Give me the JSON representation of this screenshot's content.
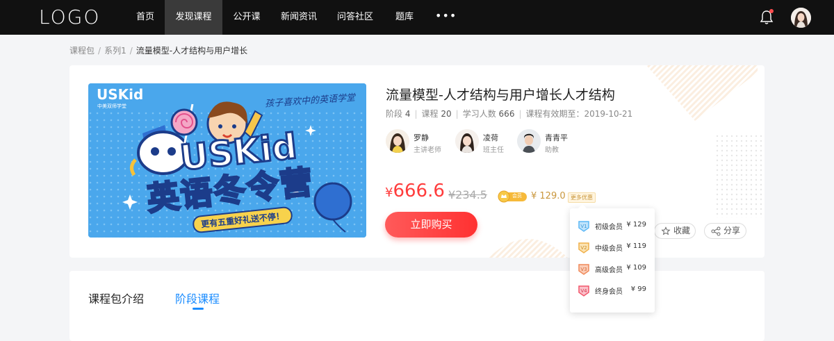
{
  "nav": {
    "logo": "LOGO",
    "items": [
      {
        "label": "首页",
        "active": false
      },
      {
        "label": "发现课程",
        "active": true
      },
      {
        "label": "公开课",
        "active": false
      },
      {
        "label": "新闻资讯",
        "active": false
      },
      {
        "label": "问答社区",
        "active": false
      },
      {
        "label": "题库",
        "active": false
      }
    ],
    "more": "•••",
    "bell_icon": "bell-icon",
    "has_notification": true
  },
  "breadcrumb": {
    "items": [
      "课程包",
      "系列1",
      "流量模型-人才结构与用户增长"
    ],
    "separator": "/"
  },
  "banner": {
    "brand": "USKid",
    "brand_sub": "中美双师学堂",
    "slogan": "孩子喜欢中的英语学堂",
    "headline": "USKid",
    "title": "英语冬令营",
    "ribbon": "更有五重好礼送不停！"
  },
  "course": {
    "title": "流量模型-人才结构与用户增长人才结构",
    "meta": {
      "stage_label": "阶段",
      "stage": "4",
      "lessons_label": "课程",
      "lessons": "20",
      "learners_label": "学习人数",
      "learners": "666",
      "valid_label": "课程有效期至：",
      "valid_until": "2019-10-21"
    },
    "teachers": [
      {
        "name": "罗静",
        "role": "主讲老师"
      },
      {
        "name": "凌荷",
        "role": "班主任"
      },
      {
        "name": "青青平",
        "role": "助教"
      }
    ],
    "price_symbol": "¥",
    "price": "666.6",
    "original_price": "¥234.5",
    "vip_badge": "会员",
    "vip_price": "¥ 129.0",
    "more_offers": "更多优惠",
    "buy_label": "立即购买",
    "favorite_label": "收藏",
    "share_label": "分享"
  },
  "member_tiers": [
    {
      "name": "初级会员",
      "price": "¥ 129",
      "color": "#5cb8f5",
      "icon": "tier-junior-icon"
    },
    {
      "name": "中级会员",
      "price": "¥ 119",
      "color": "#f0b04a",
      "icon": "tier-mid-icon"
    },
    {
      "name": "高级会员",
      "price": "¥ 109",
      "color": "#f08a5a",
      "icon": "tier-senior-icon"
    },
    {
      "name": "终身会员",
      "price": "¥ 99",
      "color": "#f2566b",
      "icon": "tier-lifetime-icon"
    }
  ],
  "tabs": [
    {
      "label": "课程包介绍",
      "active": false
    },
    {
      "label": "阶段课程",
      "active": true
    }
  ],
  "colors": {
    "accent_blue": "#1a8cff",
    "price_red": "#ff3c3c",
    "vip_gold": "#c9963b",
    "nav_bg": "#111111"
  }
}
